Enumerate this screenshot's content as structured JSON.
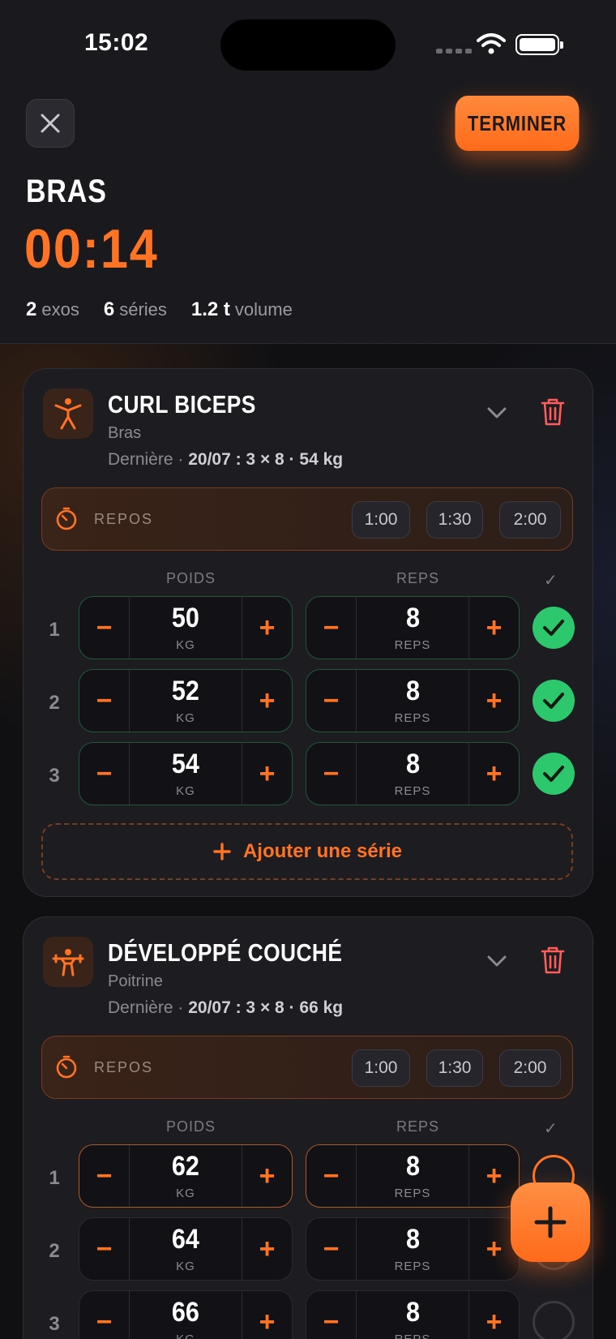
{
  "status": {
    "time": "15:02"
  },
  "header": {
    "finish_label": "TERMINER",
    "workout_title": "BRAS",
    "timer": "00:14",
    "stats": [
      {
        "value": "2",
        "label": "exos"
      },
      {
        "value": "6",
        "label": "séries"
      },
      {
        "value": "1.2 t",
        "label": "volume"
      }
    ]
  },
  "exercises": [
    {
      "name": "CURL BICEPS",
      "muscle": "Bras",
      "last_prefix": "Dernière ·",
      "last_value": "20/07 : 3 × 8 · 54 kg",
      "rest_label": "REPOS",
      "rest_options": [
        "1:00",
        "1:30",
        "2:00"
      ],
      "col_weight": "POIDS",
      "col_reps": "REPS",
      "col_check": "✓",
      "sets": [
        {
          "num": "1",
          "weight": "50",
          "weight_unit": "KG",
          "reps": "8",
          "reps_unit": "REPS",
          "done": true
        },
        {
          "num": "2",
          "weight": "52",
          "weight_unit": "KG",
          "reps": "8",
          "reps_unit": "REPS",
          "done": true
        },
        {
          "num": "3",
          "weight": "54",
          "weight_unit": "KG",
          "reps": "8",
          "reps_unit": "REPS",
          "done": true
        }
      ],
      "add_set_label": "Ajouter une série"
    },
    {
      "name": "DÉVELOPPÉ COUCHÉ",
      "muscle": "Poitrine",
      "last_prefix": "Dernière ·",
      "last_value": "20/07 : 3 × 8 · 66 kg",
      "rest_label": "REPOS",
      "rest_options": [
        "1:00",
        "1:30",
        "2:00"
      ],
      "col_weight": "POIDS",
      "col_reps": "REPS",
      "col_check": "✓",
      "sets": [
        {
          "num": "1",
          "weight": "62",
          "weight_unit": "KG",
          "reps": "8",
          "reps_unit": "REPS",
          "done": false
        },
        {
          "num": "2",
          "weight": "64",
          "weight_unit": "KG",
          "reps": "8",
          "reps_unit": "REPS",
          "done": false
        },
        {
          "num": "3",
          "weight": "66",
          "weight_unit": "KG",
          "reps": "8",
          "reps_unit": "REPS",
          "done": false
        }
      ]
    }
  ],
  "colors": {
    "accent": "#ff7324",
    "success": "#2dc76d",
    "background": "#141418"
  }
}
